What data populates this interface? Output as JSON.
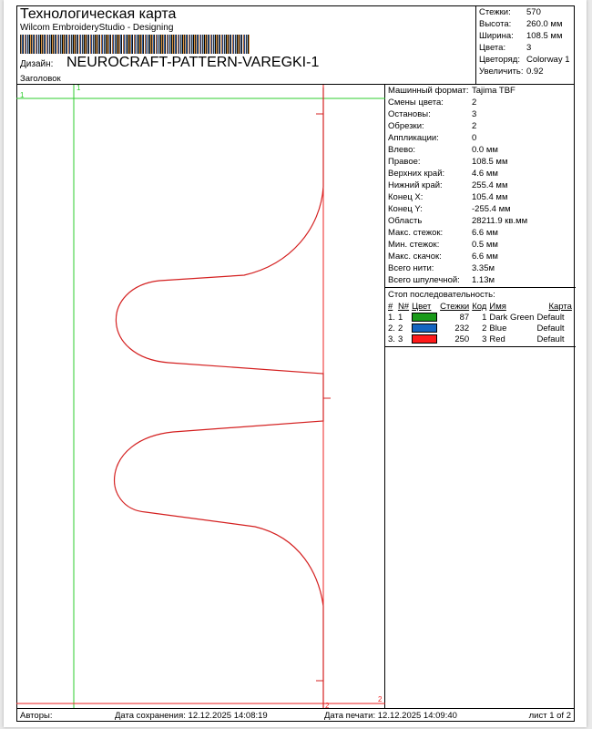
{
  "header": {
    "title": "Технологическая карта",
    "software": "Wilcom EmbroideryStudio - Designing",
    "design_label": "Дизайн:",
    "design_name": "NEUROCRAFT-PATTERN-VAREGKI-1",
    "heading_label": "Заголовок"
  },
  "stats": [
    {
      "k": "Стежки:",
      "v": "570"
    },
    {
      "k": "Высота:",
      "v": "260.0 мм"
    },
    {
      "k": "Ширина:",
      "v": "108.5 мм"
    },
    {
      "k": "Цвета:",
      "v": "3"
    },
    {
      "k": "Цветоряд:",
      "v": "Colorway 1"
    },
    {
      "k": "Увеличить:",
      "v": "0.92"
    }
  ],
  "design_markers": {
    "start": "1",
    "end": "2"
  },
  "info": [
    {
      "k": "Машинный формат:",
      "v": "Tajima TBF"
    },
    {
      "k": "Смены цвета:",
      "v": "2"
    },
    {
      "k": "Остановы:",
      "v": "3"
    },
    {
      "k": "Обрезки:",
      "v": "2"
    },
    {
      "k": "Аппликации:",
      "v": "0"
    },
    {
      "k": "Влево:",
      "v": "0.0 мм"
    },
    {
      "k": "Правое:",
      "v": "108.5 мм"
    },
    {
      "k": "Верхних край:",
      "v": "4.6 мм"
    },
    {
      "k": "Нижний край:",
      "v": "255.4 мм"
    },
    {
      "k": "Конец X:",
      "v": "105.4 мм"
    },
    {
      "k": "Конец Y:",
      "v": "-255.4 мм"
    },
    {
      "k": "Область",
      "v": "28211.9 кв.мм"
    },
    {
      "k": "Макс. стежок:",
      "v": "6.6 мм"
    },
    {
      "k": "Мин. стежок:",
      "v": "0.5 мм"
    },
    {
      "k": "Макс. скачок:",
      "v": "6.6 мм"
    },
    {
      "k": "Всего нити:",
      "v": "3.35м"
    },
    {
      "k": "Всего шпулечной:",
      "v": "1.13м"
    }
  ],
  "stop_sequence": {
    "title": "Стоп последовательность:",
    "columns": [
      "#",
      "N#",
      "Цвет",
      "Стежки",
      "Код",
      "Имя",
      "Карта"
    ],
    "rows": [
      {
        "num": "1.",
        "n": "1",
        "color": "#1a9a1a",
        "stitches": "87",
        "code": "1",
        "name": "Dark Green",
        "chart": "Default"
      },
      {
        "num": "2.",
        "n": "2",
        "color": "#1565c0",
        "stitches": "232",
        "code": "2",
        "name": "Blue",
        "chart": "Default"
      },
      {
        "num": "3.",
        "n": "3",
        "color": "#ff1a1a",
        "stitches": "250",
        "code": "3",
        "name": "Red",
        "chart": "Default"
      }
    ]
  },
  "footer": {
    "authors": "Авторы:",
    "saved": "Дата сохранения: 12.12.2025 14:08:19",
    "printed": "Дата печати: 12.12.2025 14:09:40",
    "page": "лист 1 of 2"
  }
}
